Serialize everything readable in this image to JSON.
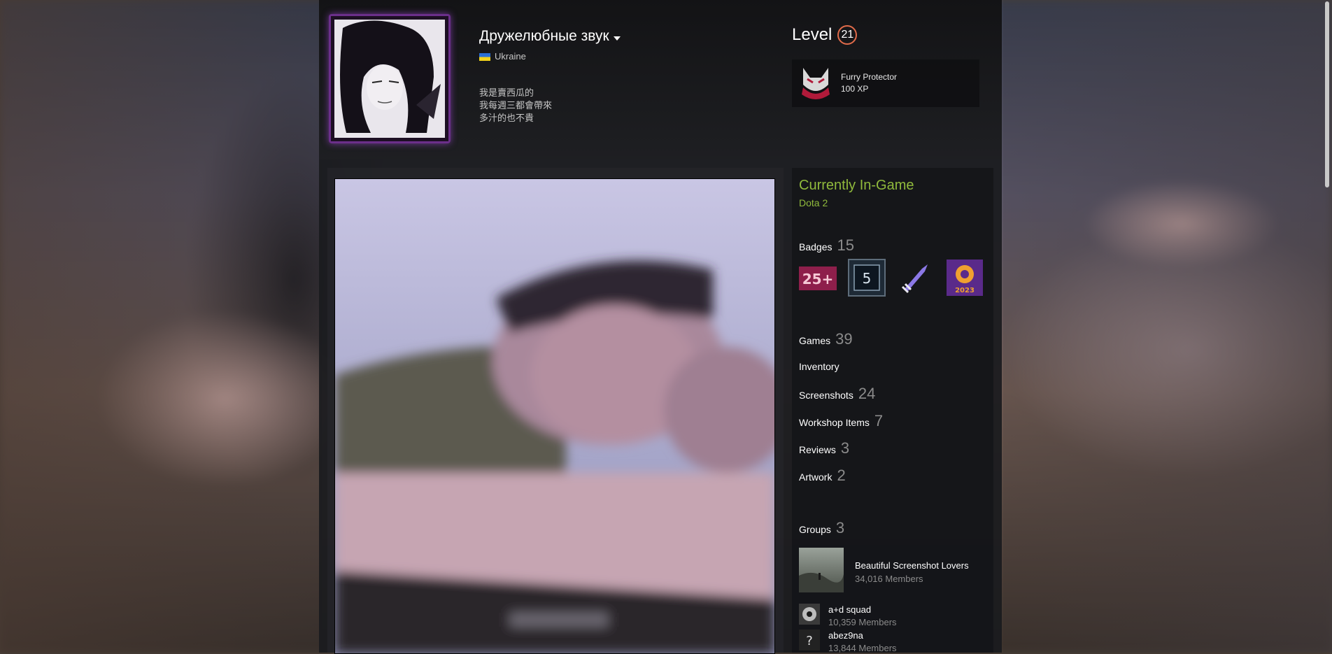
{
  "profile": {
    "persona_name": "Дружелюбные звук",
    "country": "Ukraine",
    "summary": [
      "我是賣西瓜的",
      "我每週三都會帶來",
      "多汁的也不貴"
    ]
  },
  "level": {
    "label": "Level",
    "value": "21"
  },
  "favorite_badge": {
    "name": "Furry Protector",
    "xp": "100 XP"
  },
  "ingame": {
    "title": "Currently In-Game",
    "game": "Dota 2"
  },
  "badges": {
    "label": "Badges",
    "count": "15",
    "items": [
      {
        "icon": "25-plus-badge-icon",
        "text": "25+"
      },
      {
        "icon": "years-of-service-badge-icon",
        "text": "5"
      },
      {
        "icon": "dagger-badge-icon",
        "text": ""
      },
      {
        "icon": "steam-replay-2023-badge-icon",
        "text": "2023"
      }
    ]
  },
  "counts": {
    "games": {
      "label": "Games",
      "count": "39"
    },
    "inventory": {
      "label": "Inventory"
    },
    "screenshots": {
      "label": "Screenshots",
      "count": "24"
    },
    "workshop": {
      "label": "Workshop Items",
      "count": "7"
    },
    "reviews": {
      "label": "Reviews",
      "count": "3"
    },
    "artwork": {
      "label": "Artwork",
      "count": "2"
    }
  },
  "groups": {
    "label": "Groups",
    "count": "3",
    "items": [
      {
        "name": "Beautiful Screenshot Lovers",
        "members": "34,016 Members"
      },
      {
        "name": "a+d squad",
        "members": "10,359 Members"
      },
      {
        "name": "abez9na",
        "members": "13,844 Members"
      }
    ]
  },
  "colors": {
    "ingame_green": "#90ba3c",
    "level_ring": "#e06b4a",
    "panel_bg": "#1a1b1e"
  }
}
